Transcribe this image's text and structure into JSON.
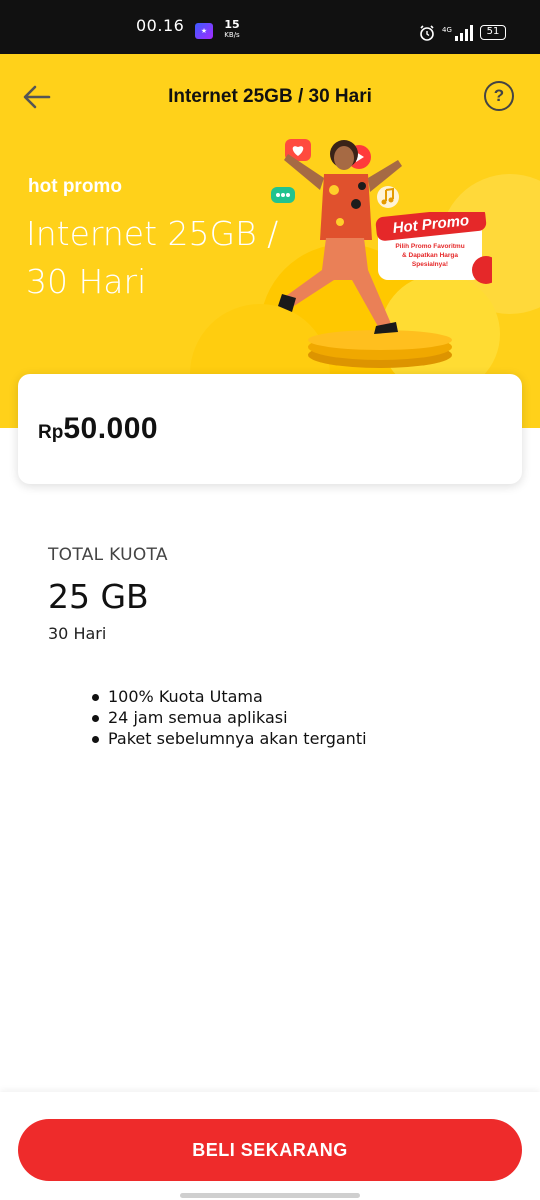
{
  "status_bar": {
    "time": "00.16",
    "speed_value": "15",
    "speed_unit": "KB/s",
    "network": "4G",
    "battery": "51"
  },
  "header": {
    "title": "Internet 25GB / 30 Hari",
    "back_icon": "arrow-left-icon",
    "help_icon": "question-circle-icon",
    "help_glyph": "?"
  },
  "hero": {
    "tag": "hot promo",
    "title": "Internet 25GB / 30 Hari",
    "badge_title": "Hot Promo",
    "badge_text": "Pilih Promo Favoritmu & Dapatkan Harga Spesialnya!"
  },
  "price": {
    "currency": "Rp",
    "amount": "50.000"
  },
  "quota": {
    "label": "TOTAL KUOTA",
    "value": "25 GB",
    "duration": "30 Hari"
  },
  "features": [
    "100% Kuota Utama",
    "24 jam semua aplikasi",
    "Paket sebelumnya akan terganti"
  ],
  "cta": {
    "label": "BELI SEKARANG"
  },
  "colors": {
    "brand_yellow": "#ffd11a",
    "cta_red": "#ee2b2b",
    "status_bar": "#111111"
  }
}
